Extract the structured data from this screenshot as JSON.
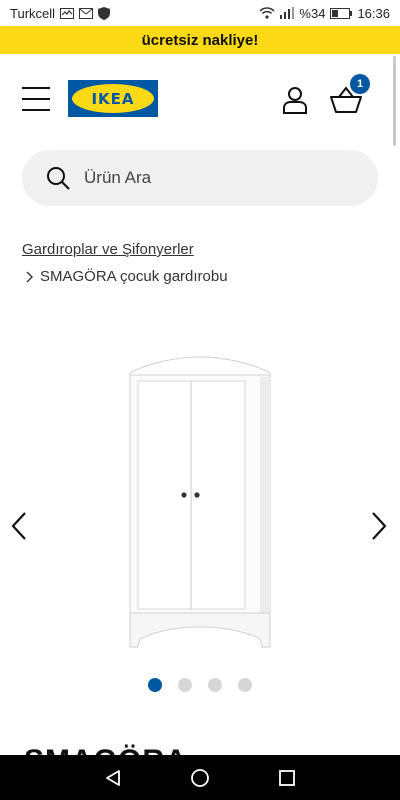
{
  "status_bar": {
    "carrier": "Turkcell",
    "battery": "%34",
    "time": "16:36"
  },
  "promo": {
    "text": "ücretsiz nakliye!"
  },
  "header": {
    "logo_text": "IKEA",
    "basket_count": "1"
  },
  "search": {
    "placeholder": "Ürün Ara"
  },
  "breadcrumb": {
    "parent": "Gardıroplar ve Şifonyerler",
    "current": "SMAGÖRA çocuk gardırobu"
  },
  "gallery": {
    "image_count": 4,
    "active_index": 0
  },
  "product": {
    "title": "SMAGÖRA"
  },
  "colors": {
    "brand_blue": "#0058a3",
    "brand_yellow": "#fbd914"
  }
}
